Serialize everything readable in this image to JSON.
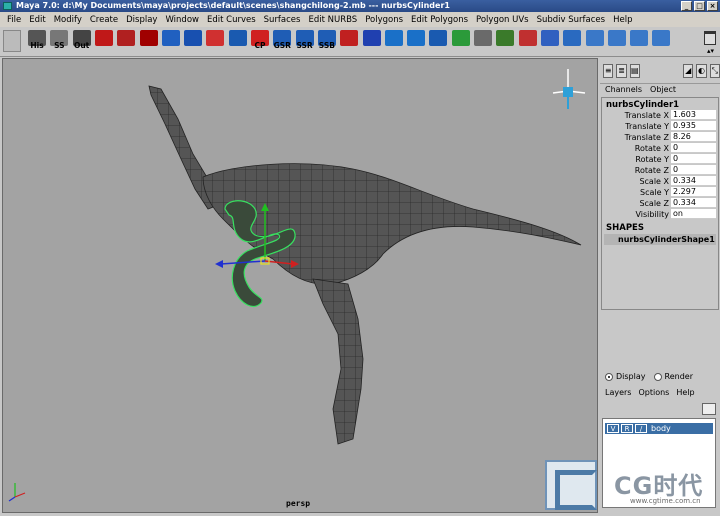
{
  "window": {
    "title": "Maya 7.0: d:\\My Documents\\maya\\projects\\default\\scenes\\shangchilong-2.mb   ---   nurbsCylinder1",
    "buttons": [
      "_",
      "□",
      "×"
    ]
  },
  "menubar": [
    "File",
    "Edit",
    "Modify",
    "Create",
    "Display",
    "Window",
    "Edit Curves",
    "Surfaces",
    "Edit NURBS",
    "Polygons",
    "Edit Polygons",
    "Polygon UVs",
    "Subdiv Surfaces",
    "Help"
  ],
  "shelf": {
    "tools": [
      {
        "name": "his",
        "label": "His",
        "color": "#555555"
      },
      {
        "name": "ss",
        "label": "SS",
        "color": "#777777"
      },
      {
        "name": "out",
        "label": "Out",
        "color": "#444444"
      },
      {
        "name": "select",
        "label": "",
        "color": "#c01818"
      },
      {
        "name": "lasso",
        "label": "",
        "color": "#b02020"
      },
      {
        "name": "move",
        "label": "",
        "color": "#a00000"
      },
      {
        "name": "split",
        "label": "",
        "color": "#2060c0"
      },
      {
        "name": "extrude",
        "label": "",
        "color": "#1850b0"
      },
      {
        "name": "bevel",
        "label": "",
        "color": "#d03030"
      },
      {
        "name": "wedge",
        "label": "",
        "color": "#1a5ab0"
      },
      {
        "name": "cp",
        "label": "CP",
        "color": "#d02020"
      },
      {
        "name": "gsr",
        "label": "GSR",
        "color": "#1f5db5"
      },
      {
        "name": "ssr",
        "label": "SSR",
        "color": "#1f5db5"
      },
      {
        "name": "ssb",
        "label": "SSB",
        "color": "#1f5db5"
      },
      {
        "name": "sew",
        "label": "",
        "color": "#c02020"
      },
      {
        "name": "circle",
        "label": "",
        "color": "#2040b0"
      },
      {
        "name": "sphere",
        "label": "",
        "color": "#1a70c8"
      },
      {
        "name": "cylinder",
        "label": "",
        "color": "#1a70c8"
      },
      {
        "name": "cube",
        "label": "",
        "color": "#1a5ab0"
      },
      {
        "name": "shader",
        "label": "",
        "color": "#2b9a3a"
      },
      {
        "name": "reflect",
        "label": "",
        "color": "#6a6a6a"
      },
      {
        "name": "normals",
        "label": "",
        "color": "#3a7a2a"
      },
      {
        "name": "combine",
        "label": "",
        "color": "#c03030"
      },
      {
        "name": "cut",
        "label": "",
        "color": "#3060c0"
      },
      {
        "name": "pivot",
        "label": "",
        "color": "#2a6ac0"
      },
      {
        "name": "mesh",
        "label": "",
        "color": "#3a78c8"
      },
      {
        "name": "smooth",
        "label": "",
        "color": "#3a78c8"
      },
      {
        "name": "subdiv",
        "label": "",
        "color": "#3a78c8"
      },
      {
        "name": "uv",
        "label": "",
        "color": "#3a78c8"
      }
    ]
  },
  "viewport": {
    "camera": "persp"
  },
  "channels": {
    "tabs": [
      "Channels",
      "Object"
    ],
    "node": "nurbsCylinder1",
    "attrs": [
      {
        "name": "Translate X",
        "value": "1.603"
      },
      {
        "name": "Translate Y",
        "value": "0.935"
      },
      {
        "name": "Translate Z",
        "value": "8.26"
      },
      {
        "name": "Rotate X",
        "value": "0"
      },
      {
        "name": "Rotate Y",
        "value": "0"
      },
      {
        "name": "Rotate Z",
        "value": "0"
      },
      {
        "name": "Scale X",
        "value": "0.334"
      },
      {
        "name": "Scale Y",
        "value": "2.297"
      },
      {
        "name": "Scale Z",
        "value": "0.334"
      },
      {
        "name": "Visibility",
        "value": "on"
      }
    ],
    "shapes_header": "SHAPES",
    "shape": "nurbsCylinderShape1"
  },
  "layers": {
    "display_label": "Display",
    "render_label": "Render",
    "menu": [
      "Layers",
      "Options",
      "Help"
    ],
    "v": "V",
    "r": "R",
    "name": "body"
  },
  "watermark": {
    "text": "CG时代",
    "url": "www.cgtime.com.cn"
  }
}
